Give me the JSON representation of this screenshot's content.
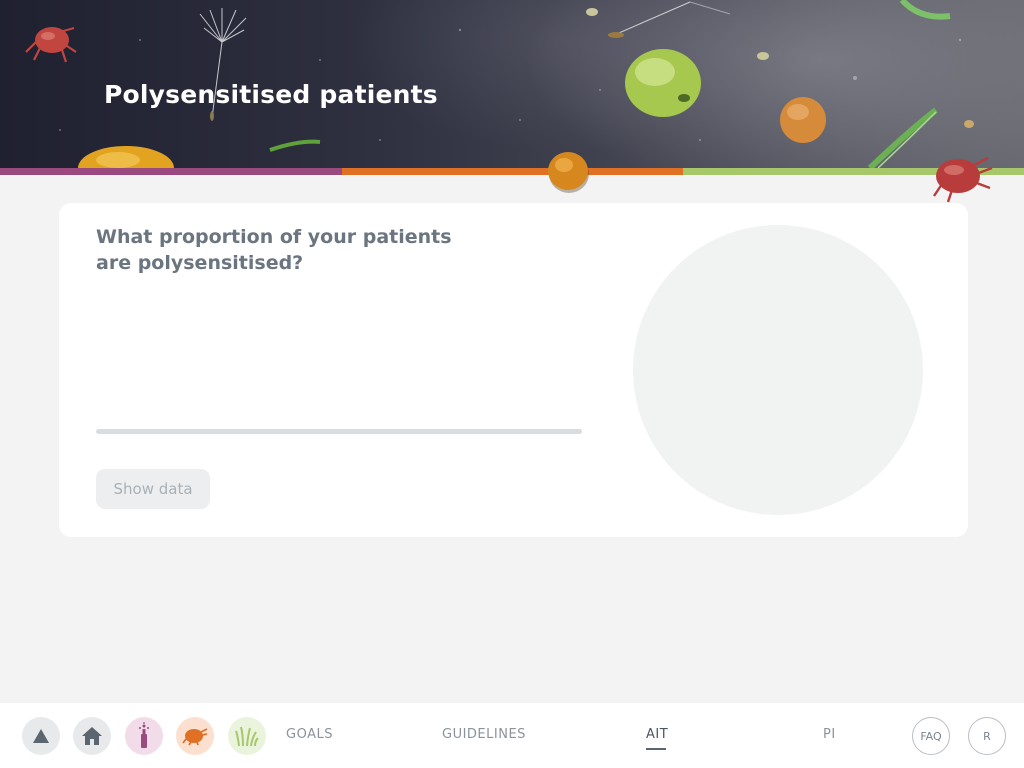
{
  "page": {
    "title": "Polysensitised patients"
  },
  "theme": {
    "purple": "#9b4a80",
    "orange": "#e07024",
    "green": "#a6c86a",
    "text_muted": "#6b7580"
  },
  "card": {
    "question": "What proportion of your patients are polysensitised?",
    "slider_value": null,
    "show_data_label": "Show data"
  },
  "nav": {
    "icon_buttons": [
      {
        "name": "up-arrow-icon",
        "bg": "#e7e9ea"
      },
      {
        "name": "home-icon",
        "bg": "#e7e9ea"
      },
      {
        "name": "tree-pollen-icon",
        "bg": "#f3dce9"
      },
      {
        "name": "house-dust-mite-icon",
        "bg": "#fbe0cf"
      },
      {
        "name": "grass-pollen-icon",
        "bg": "#eaf3dc"
      }
    ],
    "links": [
      "GOALS",
      "GUIDELINES",
      "AIT",
      "PI"
    ],
    "active_link": "AIT",
    "faq_label": "FAQ",
    "r_label": "R"
  }
}
